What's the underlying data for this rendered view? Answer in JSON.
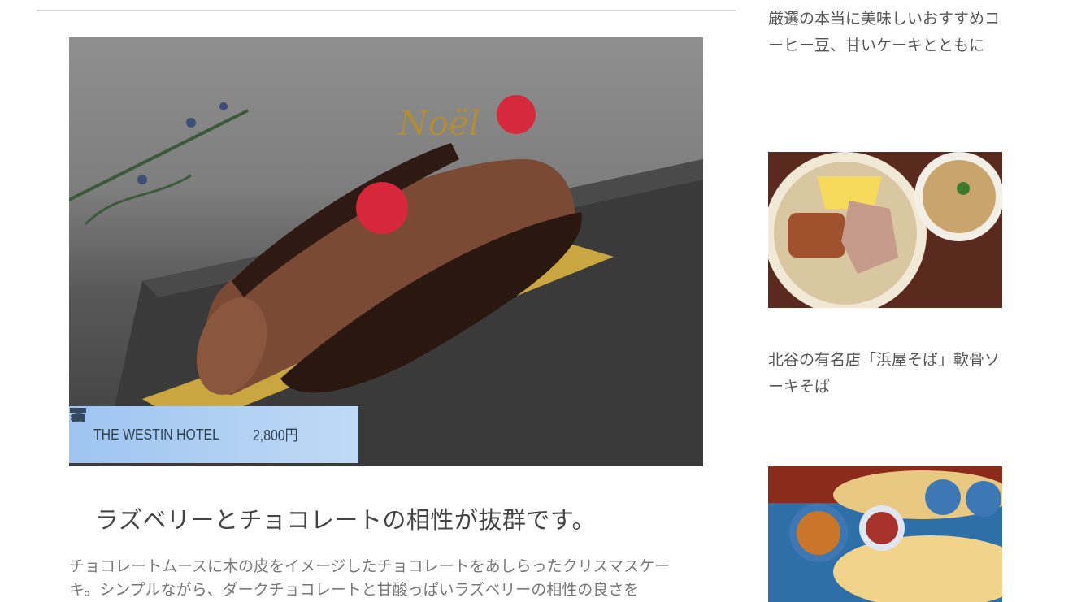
{
  "article": {
    "hotel_name": "THE WESTIN HOTEL",
    "price": "2,800円",
    "headline": "ラズベリーとチョコレートの相性が抜群です。",
    "body": "チョコレートムースに木の皮をイメージしたチョコレートをあしらったクリスマスケーキ。シンプルながら、ダークチョコレートと甘酸っぱいラズベリーの相性の良さを",
    "hero_image_label": "Noël"
  },
  "sidebar": {
    "items": [
      {
        "title": "厳選の本当に美味しいおすすめコーヒー豆、甘いケーキとともに"
      },
      {
        "title": "北谷の有名店「浜屋そば」軟骨ソーキそば"
      }
    ]
  },
  "icons": {
    "hotel": "store-icon",
    "price": "coins-icon"
  },
  "colors": {
    "info_band_start": "#9ec4f0",
    "info_band_end": "#bfdaf5",
    "text": "#555555"
  }
}
